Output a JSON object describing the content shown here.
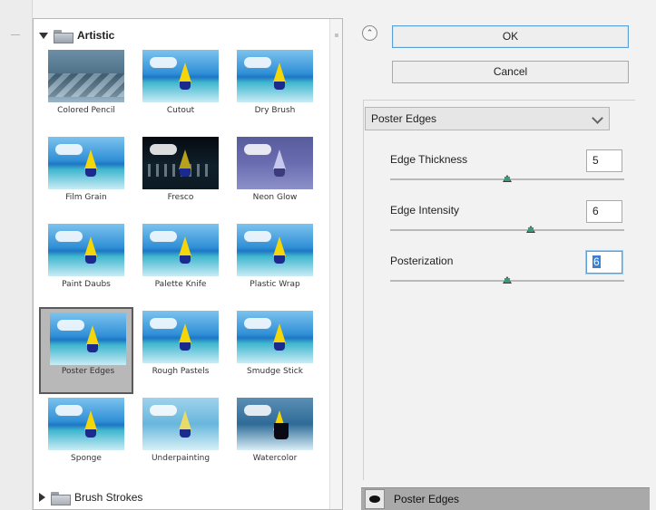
{
  "gallery": {
    "category_open": "Artistic",
    "category_closed": "Brush Strokes",
    "filters": [
      {
        "label": "Colored Pencil",
        "style": "pencil"
      },
      {
        "label": "Cutout",
        "style": "sea"
      },
      {
        "label": "Dry Brush",
        "style": "sea"
      },
      {
        "label": "Film Grain",
        "style": "sea"
      },
      {
        "label": "Fresco",
        "style": "fresco"
      },
      {
        "label": "Neon Glow",
        "style": "neon"
      },
      {
        "label": "Paint Daubs",
        "style": "sea"
      },
      {
        "label": "Palette Knife",
        "style": "sea"
      },
      {
        "label": "Plastic Wrap",
        "style": "sea"
      },
      {
        "label": "Poster Edges",
        "style": "sea",
        "selected": true
      },
      {
        "label": "Rough Pastels",
        "style": "sea"
      },
      {
        "label": "Smudge Stick",
        "style": "sea"
      },
      {
        "label": "Sponge",
        "style": "sea"
      },
      {
        "label": "Underpainting",
        "style": "under"
      },
      {
        "label": "Watercolor",
        "style": "water"
      }
    ]
  },
  "buttons": {
    "ok": "OK",
    "cancel": "Cancel"
  },
  "settings": {
    "filter_select": "Poster Edges",
    "params": [
      {
        "label": "Edge Thickness",
        "value": "5",
        "level": 0.5
      },
      {
        "label": "Edge Intensity",
        "value": "6",
        "level": 0.6
      },
      {
        "label": "Posterization",
        "value": "6",
        "level": 0.5
      }
    ]
  },
  "layers": {
    "active": "Poster Edges"
  }
}
